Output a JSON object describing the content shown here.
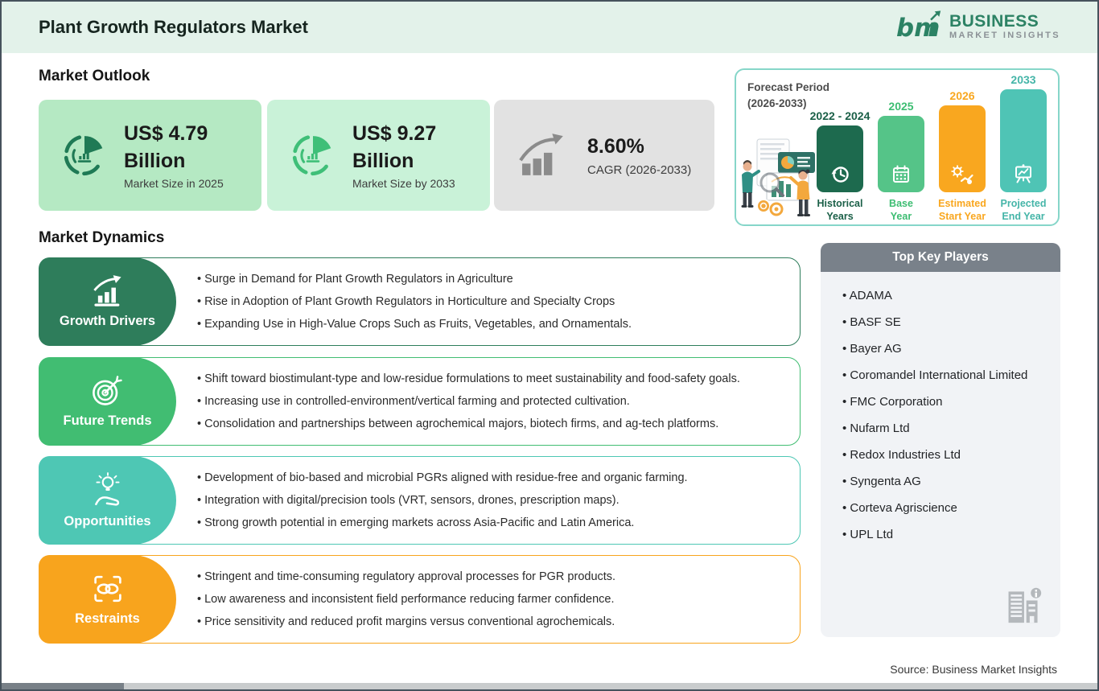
{
  "header": {
    "title": "Plant Growth Regulators Market",
    "logo": {
      "mark": "bmi",
      "name_line1": "BUSINESS",
      "name_line2": "MARKET INSIGHTS",
      "green": "#2c8264",
      "gray": "#8b9196"
    }
  },
  "market_outlook": {
    "heading": "Market Outlook",
    "cards": [
      {
        "value": "US$ 4.79",
        "unit": "Billion",
        "caption": "Market Size in 2025",
        "bg": "#b5e9c3",
        "icon": "donut-chart-icon",
        "icon_color": "#1f7a55"
      },
      {
        "value": "US$ 9.27",
        "unit": "Billion",
        "caption": "Market Size by 2033",
        "bg": "#c9f2d8",
        "icon": "donut-chart-icon",
        "icon_color": "#3fbf78"
      },
      {
        "value": "8.60%",
        "caption": "CAGR (2026-2033)",
        "bg": "#e2e2e2",
        "icon": "growth-bars-arrow-icon",
        "icon_color": "#8b8b8b"
      }
    ]
  },
  "forecast_panel": {
    "title_line1": "Forecast Period",
    "title_line2": "(2026-2033)",
    "border_color": "#86d6c9",
    "bars": [
      {
        "year": "2022 - 2024",
        "caption_line1": "Historical",
        "caption_line2": "Years",
        "color": "#1d6a4e",
        "label_color": "#1a5f47",
        "height": 83,
        "icon": "history-clock-icon"
      },
      {
        "year": "2025",
        "caption_line1": "Base",
        "caption_line2": "Year",
        "color": "#55c488",
        "label_color": "#3dbd72",
        "height": 95,
        "icon": "calendar-icon"
      },
      {
        "year": "2026",
        "caption_line1": "Estimated",
        "caption_line2": "Start Year",
        "color": "#f9a71f",
        "label_color": "#f9a71f",
        "height": 108,
        "icon": "gear-chart-icon"
      },
      {
        "year": "2033",
        "caption_line1": "Projected",
        "caption_line2": "End Year",
        "color": "#4fc4b5",
        "label_color": "#45b5a8",
        "height": 128,
        "icon": "presentation-chart-icon"
      }
    ]
  },
  "market_dynamics": {
    "heading": "Market Dynamics",
    "rows": [
      {
        "label": "Growth Drivers",
        "color": "#2e7d5b",
        "icon": "growth-chart-icon",
        "bullets": [
          "Surge in Demand for Plant Growth Regulators in Agriculture",
          "Rise in Adoption of Plant Growth Regulators in Horticulture and Specialty Crops",
          "Expanding Use in High-Value Crops Such as Fruits, Vegetables, and Ornamentals."
        ]
      },
      {
        "label": "Future Trends",
        "color": "#41bd72",
        "icon": "target-icon",
        "bullets": [
          "Shift toward biostimulant-type and low-residue formulations to meet sustainability and food-safety goals.",
          "Increasing use in controlled-environment/vertical farming and protected cultivation.",
          "Consolidation and partnerships between agrochemical majors, biotech firms, and ag-tech platforms."
        ]
      },
      {
        "label": "Opportunities",
        "color": "#4ec7b4",
        "icon": "lightbulb-hand-icon",
        "bullets": [
          "Development of bio-based and microbial PGRs aligned with residue-free and organic farming.",
          "Integration with digital/precision tools (VRT, sensors, drones, prescription maps).",
          "Strong growth potential in emerging markets across Asia-Pacific and Latin America."
        ]
      },
      {
        "label": "Restraints",
        "color": "#f8a41d",
        "icon": "chain-link-icon",
        "bullets": [
          "Stringent and time-consuming regulatory approval processes for PGR products.",
          "Low awareness and inconsistent field performance reducing farmer confidence.",
          "Price sensitivity and reduced profit margins versus conventional agrochemicals."
        ]
      }
    ]
  },
  "key_players": {
    "heading": "Top Key Players",
    "items": [
      "ADAMA",
      "BASF SE",
      "Bayer AG",
      "Coromandel International Limited",
      "FMC Corporation",
      "Nufarm Ltd",
      "Redox Industries Ltd",
      "Syngenta AG",
      "Corteva Agriscience",
      "UPL Ltd"
    ]
  },
  "footer": {
    "source": "Source: Business Market Insights"
  }
}
